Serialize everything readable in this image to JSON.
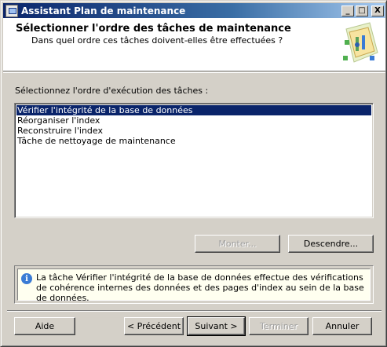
{
  "window": {
    "title": "Assistant Plan de maintenance",
    "minimize": "_",
    "maximize": "□",
    "close": "X"
  },
  "header": {
    "title": "Sélectionner l'ordre des tâches de maintenance",
    "subtitle": "Dans quel ordre ces tâches doivent-elles être effectuées ?"
  },
  "list": {
    "label": "Sélectionnez l'ordre d'exécution des tâches :",
    "items": [
      {
        "label": "Vérifier l'intégrité de la base de données",
        "selected": true
      },
      {
        "label": "Réorganiser l'index",
        "selected": false
      },
      {
        "label": "Reconstruire l'index",
        "selected": false
      },
      {
        "label": "Tâche de nettoyage de maintenance",
        "selected": false
      }
    ]
  },
  "order_buttons": {
    "up": "Monter...",
    "down": "Descendre..."
  },
  "info": {
    "icon": "info-icon",
    "text": "La tâche Vérifier l'intégrité de la base de données effectue des vérifications de cohérence internes des données et des pages d'index au sein de la base de données."
  },
  "footer": {
    "help": "Aide",
    "previous": "< Précédent",
    "next": "Suivant >",
    "finish": "Terminer",
    "cancel": "Annuler"
  }
}
